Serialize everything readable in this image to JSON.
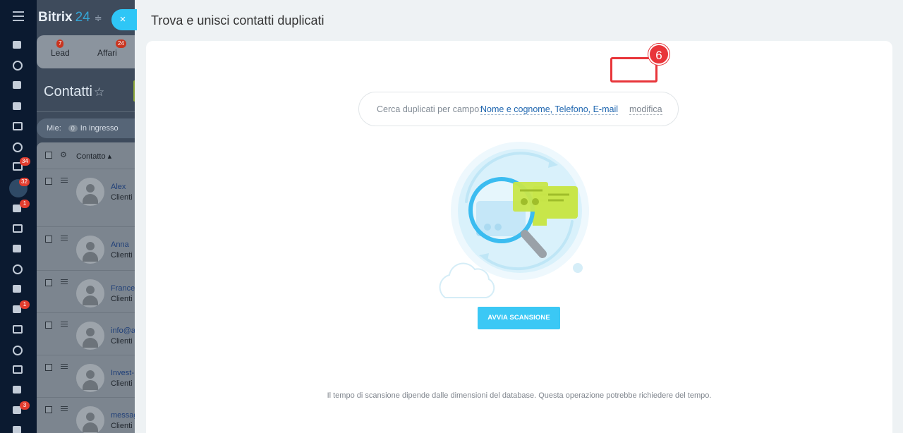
{
  "app": {
    "brand_name": "Bitrix",
    "brand_num": "24"
  },
  "nav": {
    "badges": [
      "34",
      "32",
      "1",
      "1",
      "3"
    ]
  },
  "crm": {
    "tabs": [
      {
        "label": "Lead",
        "badge": "7"
      },
      {
        "label": "Affari",
        "badge": "24"
      }
    ],
    "page_title": "Contatti",
    "filter": {
      "label": "Mie:",
      "count": "0",
      "status": "In ingresso"
    },
    "grid_header": "Contatto",
    "rows": [
      {
        "name": "Alex",
        "sub": "Clienti"
      },
      {
        "name": "Anna",
        "sub": "Clienti"
      },
      {
        "name": "Frances",
        "sub": "Clienti"
      },
      {
        "name": "info@a",
        "sub": "Clienti"
      },
      {
        "name": "Invest-",
        "sub": "Clienti"
      },
      {
        "name": "messag",
        "sub": "Clienti"
      }
    ]
  },
  "slider": {
    "close_label": "×",
    "title": "Trova e unisci contatti duplicati",
    "search_label": "Cerca duplicati per campo:",
    "search_fields": "Nome e cognome, Telefono, E-mail",
    "modify_label": "modifica",
    "step_number": "6",
    "scan_button": "AVVIA SCANSIONE",
    "footnote": "Il tempo di scansione dipende dalle dimensioni del database. Questa operazione potrebbe richiedere del tempo."
  },
  "colors": {
    "accent": "#3bc8f5",
    "highlight": "#e8353a",
    "link": "#2067b0"
  }
}
